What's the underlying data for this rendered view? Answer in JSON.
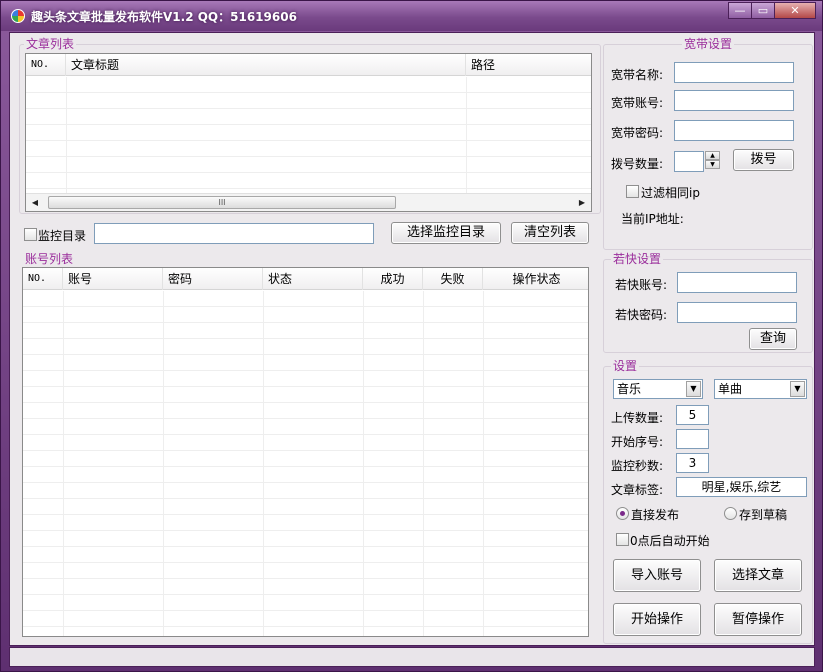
{
  "window": {
    "title": "趣头条文章批量发布软件V1.2 QQ：51619606",
    "minimize": "—",
    "restore": "▭",
    "close": "✕"
  },
  "article_list": {
    "legend": "文章列表",
    "columns": [
      "NO.",
      "文章标题",
      "路径"
    ],
    "scroll_thumb": "III",
    "scroll_left": "◀",
    "scroll_right": "▶"
  },
  "monitor": {
    "checkbox_label": "监控目录",
    "dir_value": "",
    "select_button": "选择监控目录",
    "clear_button": "清空列表"
  },
  "account_list": {
    "legend": "账号列表",
    "columns": [
      "NO.",
      "账号",
      "密码",
      "状态",
      "成功",
      "失败",
      "操作状态"
    ]
  },
  "broadband": {
    "legend": "宽带设置",
    "name_label": "宽带名称:",
    "account_label": "宽带账号:",
    "password_label": "宽带密码:",
    "dial_count_label": "拨号数量:",
    "dial_button": "拨号",
    "filter_ip_label": "过滤相同ip",
    "current_ip_label": "当前IP地址:",
    "spin_up": "▲",
    "spin_down": "▼"
  },
  "ruokuai": {
    "legend": "若快设置",
    "account_label": "若快账号:",
    "password_label": "若快密码:",
    "query_button": "查询"
  },
  "settings": {
    "legend": "设置",
    "category": "音乐",
    "subcategory": "单曲",
    "dd_arrow": "▼",
    "upload_count_label": "上传数量:",
    "upload_count": "5",
    "start_index_label": "开始序号:",
    "start_index": "",
    "monitor_seconds_label": "监控秒数:",
    "monitor_seconds": "3",
    "tags_label": "文章标签:",
    "tags": "明星,娱乐,综艺",
    "publish_direct": "直接发布",
    "save_draft": "存到草稿",
    "auto_start": "0点后自动开始",
    "import_accounts": "导入账号",
    "select_articles": "选择文章",
    "start": "开始操作",
    "pause": "暂停操作"
  }
}
